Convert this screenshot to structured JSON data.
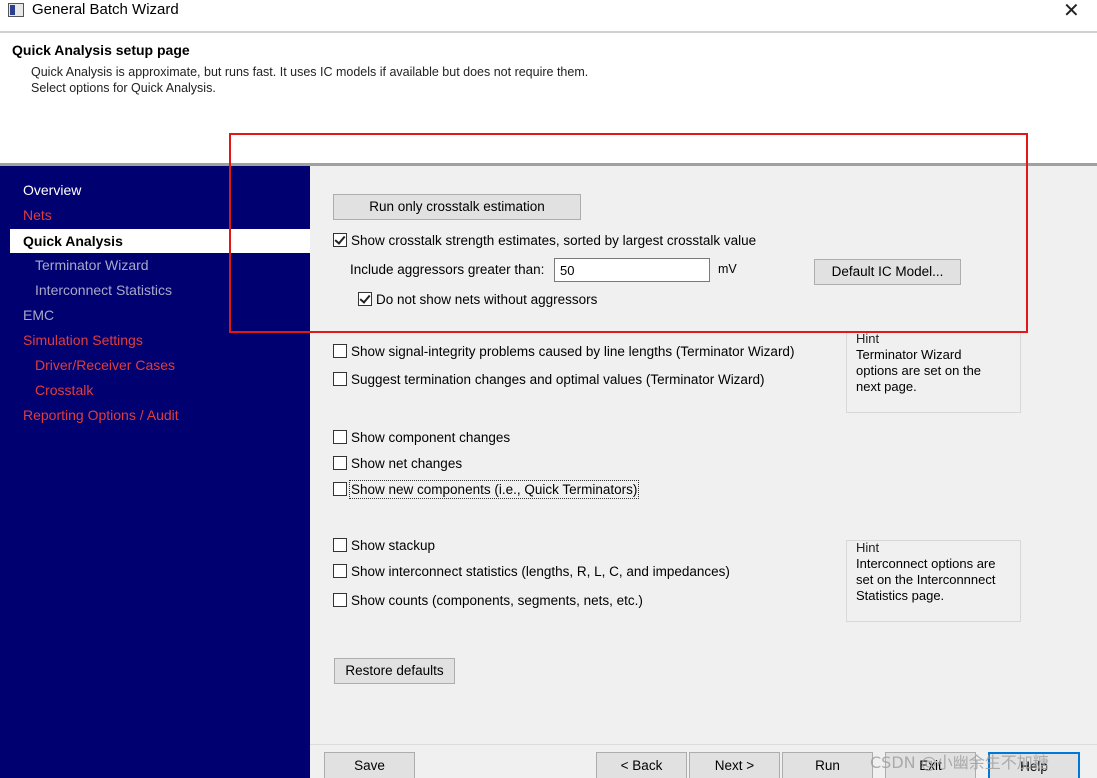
{
  "window": {
    "title": "General Batch Wizard",
    "close_glyph": "✕"
  },
  "header": {
    "title": "Quick Analysis setup page",
    "desc_line1": "Quick Analysis is approximate, but runs fast. It uses IC models if available but does not require them.",
    "desc_line2": "Select options for Quick Analysis."
  },
  "sidebar": {
    "items": [
      {
        "label": "Overview",
        "style": "white"
      },
      {
        "label": "Nets",
        "style": "red"
      },
      {
        "label": "Quick Analysis",
        "style": "selected"
      },
      {
        "label": "Terminator Wizard",
        "style": "grey"
      },
      {
        "label": "Interconnect Statistics",
        "style": "grey"
      },
      {
        "label": "EMC",
        "style": "grey"
      },
      {
        "label": "Simulation Settings",
        "style": "red"
      },
      {
        "label": "Driver/Receiver Cases",
        "style": "red"
      },
      {
        "label": "Crosstalk",
        "style": "red"
      },
      {
        "label": "Reporting Options / Audit",
        "style": "red"
      }
    ]
  },
  "crosstalk": {
    "run_button": "Run only crosstalk estimation",
    "show_strength": {
      "label": "Show crosstalk strength estimates, sorted by largest crosstalk value",
      "checked": true
    },
    "aggressor_label": "Include aggressors greater than:",
    "aggressor_value": "50",
    "aggressor_unit": "mV",
    "default_ic_button": "Default IC Model...",
    "hide_no_aggressor": {
      "label": "Do not show nets without aggressors",
      "checked": true
    }
  },
  "terminator": {
    "si_problems": {
      "label": "Show signal-integrity problems caused by line lengths (Terminator Wizard)",
      "checked": false
    },
    "suggest_termination": {
      "label": "Suggest termination changes and optimal values (Terminator Wizard)",
      "checked": false
    },
    "hint_label": "Hint",
    "hint_lines": [
      "Terminator Wizard",
      "options are set on the",
      "next page."
    ]
  },
  "changes": {
    "component_changes": {
      "label": "Show component changes",
      "checked": false
    },
    "net_changes": {
      "label": "Show net changes",
      "checked": false
    },
    "new_components": {
      "label": "Show new components  (i.e., Quick Terminators)",
      "checked": false
    }
  },
  "interconnect": {
    "stackup": {
      "label": "Show stackup",
      "checked": false
    },
    "statistics": {
      "label": "Show interconnect statistics (lengths, R, L, C, and impedances)",
      "checked": false
    },
    "counts": {
      "label": "Show counts (components, segments, nets, etc.)",
      "checked": false
    },
    "hint_label": "Hint",
    "hint_lines": [
      "Interconnect options are",
      "set on the Interconnnect",
      "Statistics page."
    ]
  },
  "restore_button": "Restore defaults",
  "footer": {
    "save": "Save",
    "back": "< Back",
    "next": "Next >",
    "run": "Run",
    "exit": "Exit",
    "help": "Help"
  },
  "watermark": "CSDN @小幽余生不加糖",
  "colors": {
    "sidebar_bg": "#000070",
    "sidebar_active_text": "#ffffff",
    "sidebar_link_red": "#e03c3c",
    "sidebar_disabled": "#a8a8c8",
    "annotation_red": "#e01818"
  }
}
